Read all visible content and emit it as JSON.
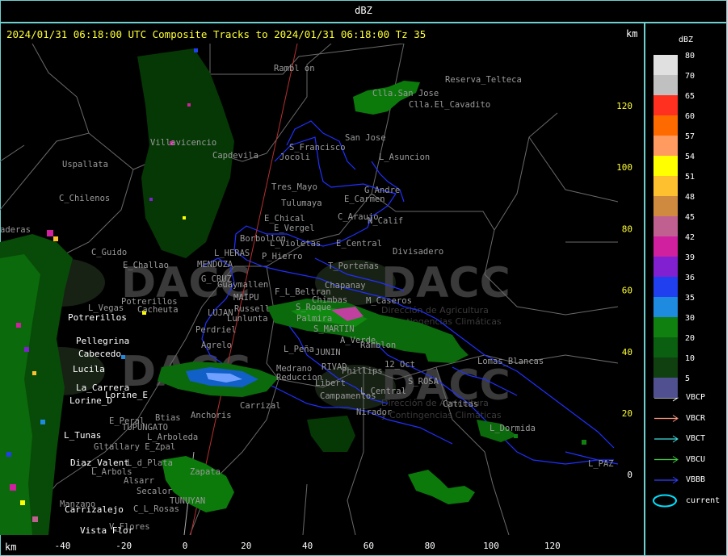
{
  "top_title": "dBZ",
  "header": "2024/01/31 06:18:00 UTC Composite Tracks to 2024/01/31 06:18:00 Tz 35",
  "axis_unit": "km",
  "x_ticks": [
    "-40",
    "-20",
    "0",
    "20",
    "40",
    "60",
    "80",
    "100",
    "120"
  ],
  "y_ticks": [
    "120",
    "100",
    "80",
    "60",
    "40",
    "20",
    "0"
  ],
  "colorbar": {
    "title": "dBZ",
    "levels": [
      {
        "value": "80",
        "color": "#e0e0e0"
      },
      {
        "value": "70",
        "color": "#c0c0c0"
      },
      {
        "value": "65",
        "color": "#ff3020"
      },
      {
        "value": "60",
        "color": "#ff6a00"
      },
      {
        "value": "57",
        "color": "#ff9a60"
      },
      {
        "value": "54",
        "color": "#ffff00"
      },
      {
        "value": "51",
        "color": "#ffc030"
      },
      {
        "value": "48",
        "color": "#d08a40"
      },
      {
        "value": "45",
        "color": "#c06090"
      },
      {
        "value": "42",
        "color": "#d020a0"
      },
      {
        "value": "39",
        "color": "#8020d0"
      },
      {
        "value": "36",
        "color": "#2040f0"
      },
      {
        "value": "35",
        "color": "#1e8ae0"
      },
      {
        "value": "30",
        "color": "#108010"
      },
      {
        "value": "20",
        "color": "#0a6010"
      },
      {
        "value": "10",
        "color": "#104010"
      },
      {
        "value": "5",
        "color": "#505090"
      }
    ]
  },
  "legend": [
    {
      "label": "VBCP",
      "color": "#ffffff"
    },
    {
      "label": "VBCR",
      "color": "#ff9a80"
    },
    {
      "label": "VBCT",
      "color": "#40e0e0"
    },
    {
      "label": "VBCU",
      "color": "#40d040"
    },
    {
      "label": "VBBB",
      "color": "#3040ff"
    },
    {
      "label": "current",
      "color": "#00e0ff"
    }
  ],
  "watermark": {
    "text": "DACC",
    "sub1": "Dirección de Agricultura",
    "sub2": "y Contingencias Climáticas"
  },
  "places_gray": [
    {
      "name": "Rambl on"
    },
    {
      "name": "Reserva_Telteca"
    },
    {
      "name": "Clla.San Jose"
    },
    {
      "name": "Clla.El_Cavadito"
    },
    {
      "name": "San Jose"
    },
    {
      "name": "S_Francisco"
    },
    {
      "name": "Jocoli"
    },
    {
      "name": "L_Asuncion"
    },
    {
      "name": "Villavicencio"
    },
    {
      "name": "Capdevila"
    },
    {
      "name": "Uspallata"
    },
    {
      "name": "C_Chilenos"
    },
    {
      "name": "Tres_Mayo"
    },
    {
      "name": "G_Andre"
    },
    {
      "name": "E_Carmen"
    },
    {
      "name": "Tulumaya"
    },
    {
      "name": "E_Chical"
    },
    {
      "name": "C_Araujo"
    },
    {
      "name": "E_Vergel"
    },
    {
      "name": "N_Calif"
    },
    {
      "name": "Borbollon"
    },
    {
      "name": "L_Violetas"
    },
    {
      "name": "E_Central"
    },
    {
      "name": "Divisadero"
    },
    {
      "name": "aderas"
    },
    {
      "name": "C_Guido"
    },
    {
      "name": "E_Challao"
    },
    {
      "name": "L_HERAS"
    },
    {
      "name": "P_Hierro"
    },
    {
      "name": "T_Porteñas"
    },
    {
      "name": "MENDOZA"
    },
    {
      "name": "G_CRUZ"
    },
    {
      "name": "Chapanay"
    },
    {
      "name": "Guaymallen"
    },
    {
      "name": "F_L_Beltran"
    },
    {
      "name": "MAIPU"
    },
    {
      "name": "Chimbas"
    },
    {
      "name": "M_Caseros"
    },
    {
      "name": "L_Vegas"
    },
    {
      "name": "Potrerillos"
    },
    {
      "name": "Russell"
    },
    {
      "name": "S_Roque"
    },
    {
      "name": "Cacheuta"
    },
    {
      "name": "LUJAN"
    },
    {
      "name": "Lunlunta"
    },
    {
      "name": "Palmira"
    },
    {
      "name": "S_MARTIN"
    },
    {
      "name": "Perdriel"
    },
    {
      "name": "Agrelo"
    },
    {
      "name": "A_Verde"
    },
    {
      "name": "Ramblon"
    },
    {
      "name": "L_Peña"
    },
    {
      "name": "JUNIN"
    },
    {
      "name": "Lomas_Blancas"
    },
    {
      "name": "Medrano"
    },
    {
      "name": "RIVAD"
    },
    {
      "name": "12_Oct"
    },
    {
      "name": "Reduccion"
    },
    {
      "name": "Phillips"
    },
    {
      "name": "S_ROSA"
    },
    {
      "name": "Libert"
    },
    {
      "name": "L_Central"
    },
    {
      "name": "Campamentos"
    },
    {
      "name": "Catitas"
    },
    {
      "name": "Carrizal"
    },
    {
      "name": "Nirador"
    },
    {
      "name": "L_Dormida"
    },
    {
      "name": "E_Peral"
    },
    {
      "name": "Btias"
    },
    {
      "name": "Anchoris"
    },
    {
      "name": "TUPUNGATO"
    },
    {
      "name": "L_Arboleda"
    },
    {
      "name": "Gltallary E_Zpal"
    },
    {
      "name": "L_d_Plata"
    },
    {
      "name": "L_Arbols"
    },
    {
      "name": "Alsarr"
    },
    {
      "name": "Secalor"
    },
    {
      "name": "Zapata"
    },
    {
      "name": "TUNUYAN"
    },
    {
      "name": "C_L_Rosas"
    },
    {
      "name": "Manzano"
    },
    {
      "name": "V_Flores"
    },
    {
      "name": "L_PAZ"
    }
  ],
  "places_white": [
    {
      "name": "Potrerillos"
    },
    {
      "name": "Pellegrina"
    },
    {
      "name": "Cabecedo"
    },
    {
      "name": "Lucila"
    },
    {
      "name": "La_Carrera"
    },
    {
      "name": "Lorine_D"
    },
    {
      "name": "Lorine_E"
    },
    {
      "name": "L_Tunas"
    },
    {
      "name": "Diaz_Valent"
    },
    {
      "name": "Carrizalejo"
    },
    {
      "name": "Vista_Flor"
    }
  ]
}
